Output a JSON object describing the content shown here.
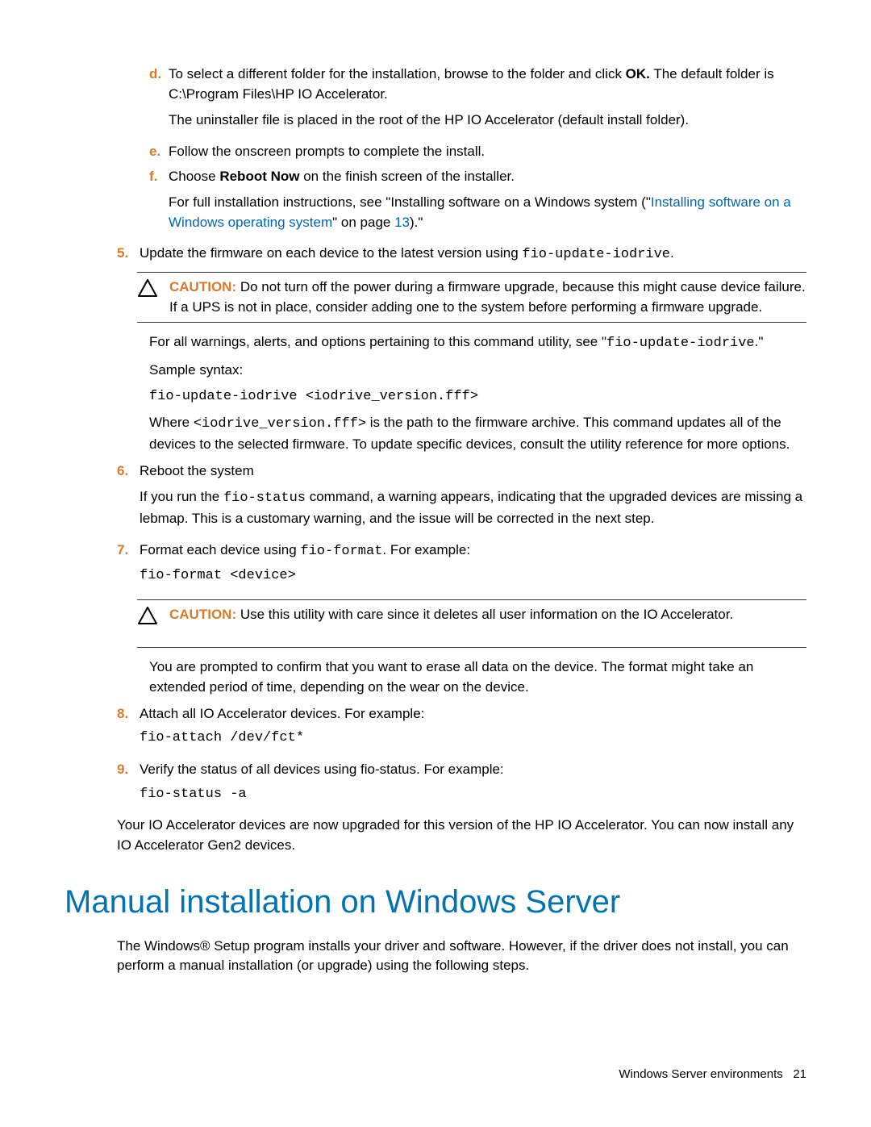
{
  "sub_d": {
    "marker": "d.",
    "text_before_bold": "To select a different folder for the installation, browse to the folder and click ",
    "bold": "OK.",
    "text_after_bold": " The default folder is C:\\Program Files\\HP IO Accelerator.",
    "line2": "The uninstaller file is placed in the root of the HP IO Accelerator (default install folder)."
  },
  "sub_e": {
    "marker": "e.",
    "text": "Follow the onscreen prompts to complete the install."
  },
  "sub_f": {
    "marker": "f.",
    "pre": "Choose ",
    "bold": "Reboot Now",
    "post": " on the finish screen of the installer.",
    "line2_pre": "For full installation instructions, see \"Installing software on a Windows system (\"",
    "line2_link": "Installing software on a Windows operating system",
    "line2_mid": "\" on page ",
    "line2_page": "13",
    "line2_end": ").\""
  },
  "step5": {
    "marker": "5.",
    "text_pre": "Update the firmware on each device to the latest version using ",
    "code": "fio-update-iodrive",
    "text_post": "."
  },
  "caution1": {
    "label": "CAUTION:",
    "text": "  Do not turn off the power during a firmware upgrade, because this might cause device failure. If a UPS is not in place, consider adding one to the system before performing a firmware upgrade."
  },
  "step5_body": {
    "l1_pre": "For all warnings, alerts, and options pertaining to this command utility, see \"",
    "l1_code": "fio-update-iodrive",
    "l1_post": ".\"",
    "l2": "Sample syntax:",
    "l3": "fio-update-iodrive <iodrive_version.fff>",
    "l4_pre": "Where ",
    "l4_code": "<iodrive_version.fff>",
    "l4_post": " is the path to the firmware archive. This command updates all of the devices to the selected firmware. To update specific devices, consult the utility reference for more options."
  },
  "step6": {
    "marker": "6.",
    "text": "Reboot the system",
    "body_pre": "If you run the ",
    "body_code": "fio-status",
    "body_post": " command, a warning appears, indicating that the upgraded devices are missing a lebmap. This is a customary warning, and the issue will be corrected in the next step."
  },
  "step7": {
    "marker": "7.",
    "text_pre": "Format each device using ",
    "text_code": "fio-format",
    "text_post": ". For example:",
    "code_line": "fio-format <device>"
  },
  "caution2": {
    "label": "CAUTION:",
    "text": "  Use this utility with care since it deletes all user information on the IO Accelerator."
  },
  "step7_body": "You are prompted to confirm that you want to erase all data on the device. The format might take an extended period of time, depending on the wear on the device.",
  "step8": {
    "marker": "8.",
    "text": "Attach all IO Accelerator devices. For example:",
    "code": "fio-attach /dev/fct*"
  },
  "step9": {
    "marker": "9.",
    "text": "Verify the status of all devices using fio-status. For example:",
    "code": "fio-status -a"
  },
  "closing": "Your IO Accelerator devices are now upgraded for this version of the HP IO Accelerator. You can now install any IO Accelerator Gen2 devices.",
  "section_title": "Manual installation on Windows Server",
  "section_body": "The Windows® Setup program installs your driver and software. However, if the driver does not install, you can perform a manual installation (or upgrade) using the following steps.",
  "footer_text": "Windows Server environments",
  "footer_page": "21"
}
